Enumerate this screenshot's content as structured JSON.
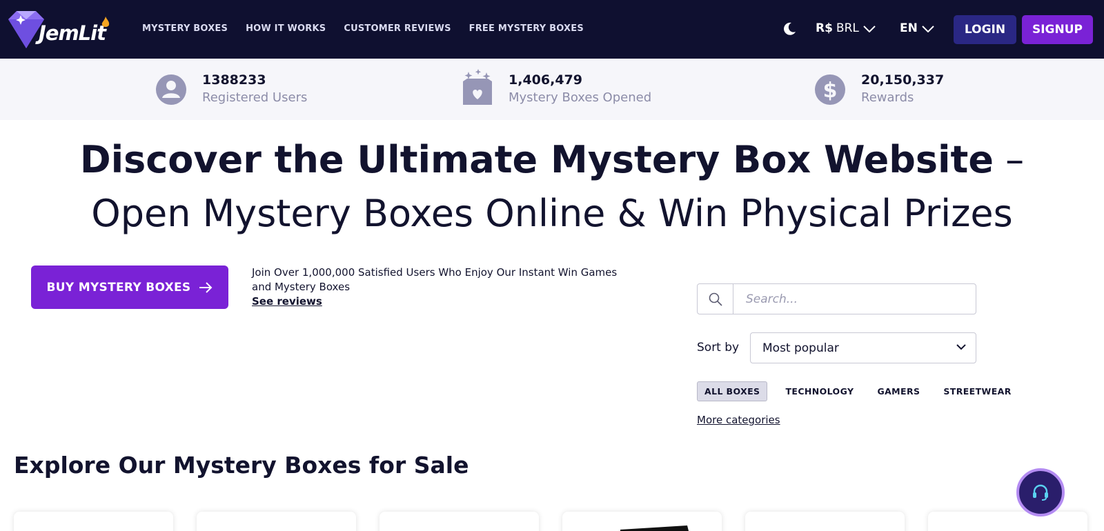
{
  "brand": {
    "name": "JemLit"
  },
  "nav": {
    "links": [
      "MYSTERY BOXES",
      "HOW IT WORKS",
      "CUSTOMER REVIEWS",
      "FREE MYSTERY BOXES"
    ],
    "currency_symbol": "R$",
    "currency_code": "BRL",
    "language": "EN",
    "login_label": "LOGIN",
    "signup_label": "SIGNUP"
  },
  "stats": [
    {
      "icon": "user-icon",
      "value": "1388233",
      "label": "Registered Users"
    },
    {
      "icon": "box-heart-icon",
      "value": "1,406,479",
      "label": "Mystery Boxes Opened"
    },
    {
      "icon": "dollar-icon",
      "value": "20,150,337",
      "label": "Rewards"
    }
  ],
  "hero": {
    "bold": "Discover the Ultimate Mystery Box Website",
    "light": " – Open Mystery Boxes Online & Win Physical Prizes"
  },
  "cta": {
    "buy_label": "BUY MYSTERY BOXES",
    "intro_text": "Join Over 1,000,000 Satisfied Users Who Enjoy Our Instant Win Games and Mystery Boxes",
    "reviews_link": "See reviews"
  },
  "filters": {
    "search_placeholder": "Search...",
    "sort_label": "Sort by",
    "sort_value": "Most popular",
    "categories": [
      "ALL BOXES",
      "TECHNOLOGY",
      "GAMERS",
      "STREETWEAR"
    ],
    "active_category": "ALL BOXES",
    "more_categories": "More categories"
  },
  "explore": {
    "title": "Explore Our Mystery Boxes for Sale"
  },
  "colors": {
    "navbar_bg": "#0f1030",
    "accent_purple": "#7a22d6",
    "login_bg": "#2a2784",
    "stats_bg": "#f6f6fa",
    "text_dark": "#12132e"
  }
}
